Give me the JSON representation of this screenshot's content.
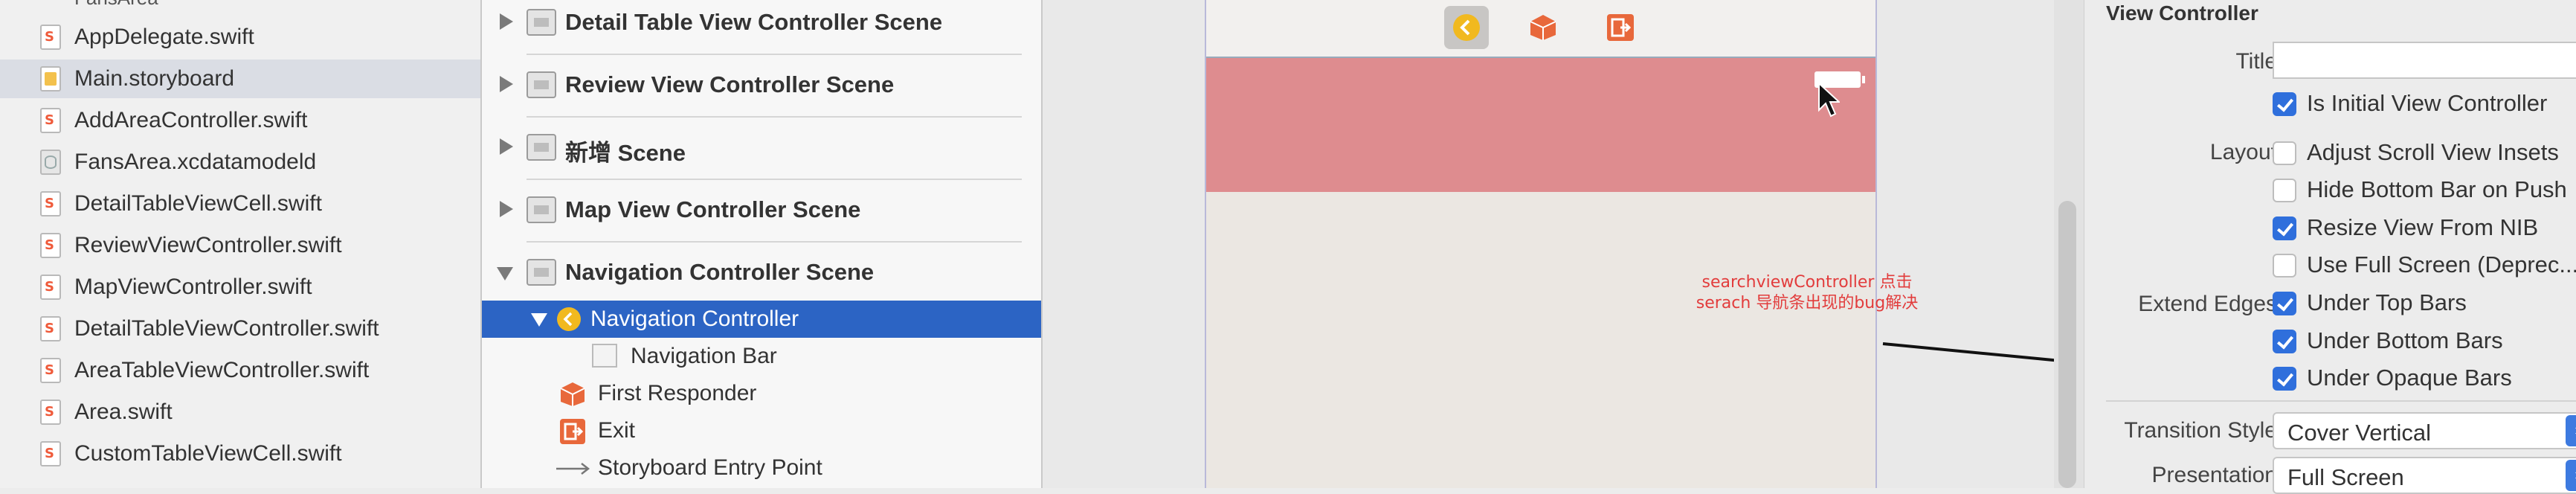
{
  "navigator": {
    "top_partial": "FansArea",
    "files": [
      {
        "name": "AppDelegate.swift",
        "kind": "swift"
      },
      {
        "name": "Main.storyboard",
        "kind": "storyboard",
        "selected": true
      },
      {
        "name": "AddAreaController.swift",
        "kind": "swift"
      },
      {
        "name": "FansArea.xcdatamodeld",
        "kind": "datamodel"
      },
      {
        "name": "DetailTableViewCell.swift",
        "kind": "swift"
      },
      {
        "name": "ReviewViewController.swift",
        "kind": "swift"
      },
      {
        "name": "MapViewController.swift",
        "kind": "swift"
      },
      {
        "name": "DetailTableViewController.swift",
        "kind": "swift"
      },
      {
        "name": "AreaTableViewController.swift",
        "kind": "swift"
      },
      {
        "name": "Area.swift",
        "kind": "swift"
      },
      {
        "name": "CustomTableViewCell.swift",
        "kind": "swift"
      }
    ]
  },
  "outline": {
    "scenes": [
      {
        "label": "Detail Table View Controller Scene",
        "expanded": false
      },
      {
        "label": "Review View Controller Scene",
        "expanded": false
      },
      {
        "label": "新增 Scene",
        "expanded": false
      },
      {
        "label": "Map View Controller Scene",
        "expanded": false
      },
      {
        "label": "Navigation Controller Scene",
        "expanded": true
      }
    ],
    "children": [
      {
        "label": "Navigation Controller",
        "selected": true
      },
      {
        "label": "Navigation Bar"
      },
      {
        "label": "First Responder"
      },
      {
        "label": "Exit"
      },
      {
        "label": "Storyboard Entry Point"
      }
    ]
  },
  "canvas": {
    "annotation": "searchviewController 点击serach 导航条出现的bug解决",
    "colors": {
      "nav_bar": "#de8c8f",
      "annotation": "#e23c3c"
    }
  },
  "inspector": {
    "section_title": "View Controller",
    "title_label": "Title",
    "title_value": "",
    "is_initial": {
      "label": "Is Initial View Controller",
      "checked": true
    },
    "layout_label": "Layout",
    "layout_options": [
      {
        "label": "Adjust Scroll View Insets",
        "checked": false
      },
      {
        "label": "Hide Bottom Bar on Push",
        "checked": false
      },
      {
        "label": "Resize View From NIB",
        "checked": true
      },
      {
        "label": "Use Full Screen (Deprec...",
        "checked": false
      }
    ],
    "extend_edges_label": "Extend Edges",
    "extend_edges": [
      {
        "label": "Under Top Bars",
        "checked": true
      },
      {
        "label": "Under Bottom Bars",
        "checked": true
      },
      {
        "label": "Under Opaque Bars",
        "checked": true
      }
    ],
    "transition_style_label": "Transition Style",
    "transition_style_value": "Cover Vertical",
    "presentation_label": "Presentation",
    "presentation_value": "Full Screen",
    "colors": {
      "checkbox_accent": "#2f6fdc"
    }
  }
}
